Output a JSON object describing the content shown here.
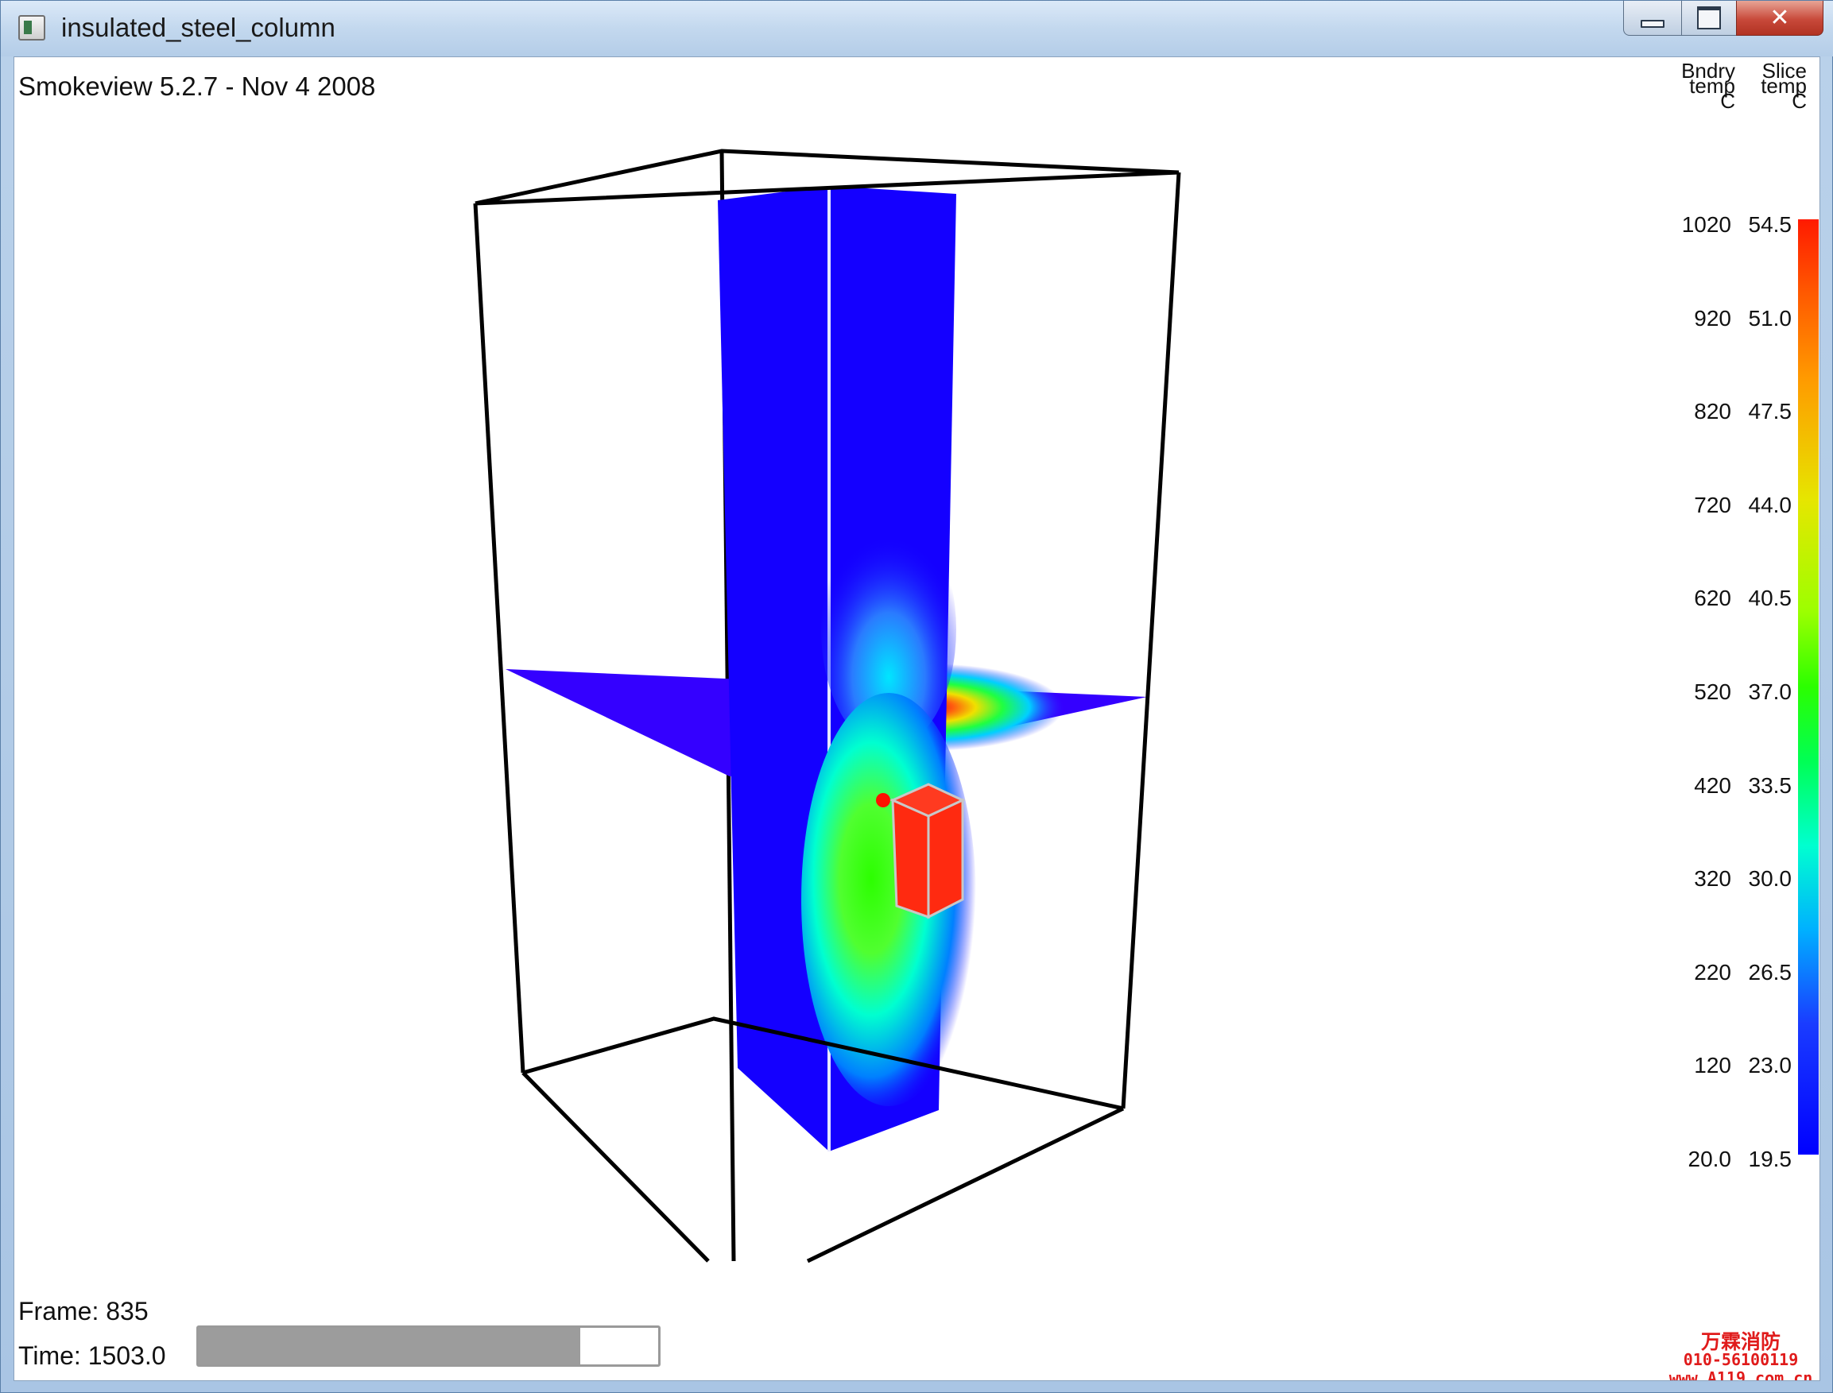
{
  "window": {
    "title": "insulated_steel_column",
    "buttons": {
      "minimize": "minimize",
      "maximize": "maximize",
      "close": "✕"
    }
  },
  "viewer": {
    "version": "Smokeview 5.2.7 - Nov  4 2008",
    "frame_label": "Frame: 835",
    "time_label": "Time: 1503.0",
    "time_progress": 0.83
  },
  "legend": {
    "boundary_header": "Bndry\ntemp\nC",
    "slice_header": "Slice\ntemp\nC",
    "boundary_values": [
      "1020",
      "920",
      "820",
      "720",
      "620",
      "520",
      "420",
      "320",
      "220",
      "120",
      "20.0"
    ],
    "slice_values": [
      "54.5",
      "51.0",
      "47.5",
      "44.0",
      "40.5",
      "37.0",
      "33.5",
      "30.0",
      "26.5",
      "23.0",
      "19.5"
    ]
  },
  "colors": {
    "slice_blue": "#1400ff",
    "plane_purple": "#3400ff",
    "hot_red": "#ff2a10",
    "frame_black": "#000000"
  },
  "watermark": {
    "name": "万霖消防",
    "phone": "010-56100119",
    "url": "www.A119.com.cn"
  }
}
